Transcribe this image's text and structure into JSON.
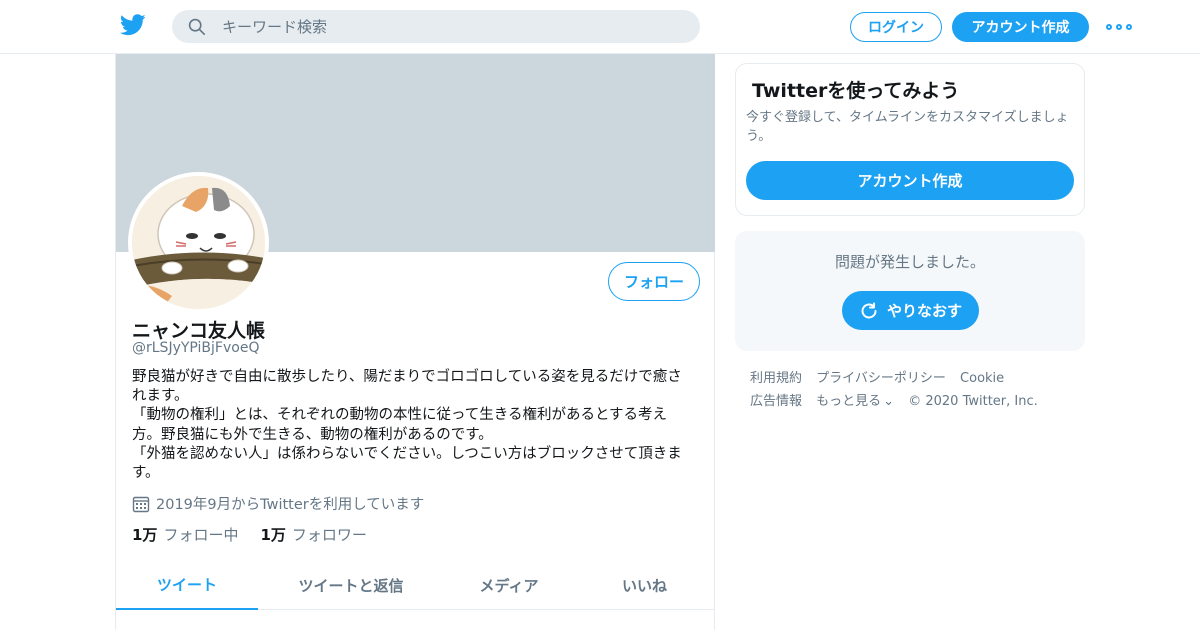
{
  "header": {
    "search_placeholder": "キーワード検索",
    "login_label": "ログイン",
    "signup_label": "アカウント作成"
  },
  "profile": {
    "follow_label": "フォロー",
    "name": "ニャンコ友人帳",
    "handle": "@rLSJyYPiBjFvoeQ",
    "bio_lines": [
      "野良猫が好きで自由に散歩したり、陽だまりでゴロゴロしている姿を見るだけで癒されます。",
      "「動物の権利」とは、それぞれの動物の本性に従って生きる権利があるとする考え方。野良猫にも外で生きる、動物の権利があるのです。",
      "「外猫を認めない人」は係わらないでください。しつこい方はブロックさせて頂きます。"
    ],
    "joined": "2019年9月からTwitterを利用しています",
    "following_count": "1万",
    "following_label": "フォロー中",
    "followers_count": "1万",
    "followers_label": "フォロワー"
  },
  "tabs": [
    {
      "label": "ツイート",
      "active": true
    },
    {
      "label": "ツイートと返信",
      "active": false
    },
    {
      "label": "メディア",
      "active": false
    },
    {
      "label": "いいね",
      "active": false
    }
  ],
  "sidebar": {
    "signup_card": {
      "title": "Twitterを使ってみよう",
      "subtitle": "今すぐ登録して、タイムラインをカスタマイズしましょう。",
      "cta": "アカウント作成"
    },
    "error_card": {
      "message": "問題が発生しました。",
      "retry": "やりなおす"
    },
    "footer": {
      "terms": "利用規約",
      "privacy": "プライバシーポリシー",
      "cookie": "Cookie",
      "ads": "広告情報",
      "more": "もっと見る",
      "copyright": "© 2020 Twitter, Inc."
    }
  },
  "colors": {
    "accent": "#1da1f2",
    "secondary_text": "#657786",
    "banner": "#ccd6dd"
  }
}
